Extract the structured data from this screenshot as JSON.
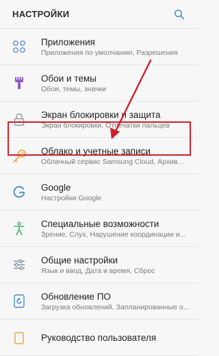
{
  "header": {
    "title": "НАСТРОЙКИ"
  },
  "items": [
    {
      "title": "Приложения",
      "subtitle": "Приложения по умолчанию, Разрешения",
      "icon": "apps-grid-icon",
      "color": "#5b8fd6"
    },
    {
      "title": "Обои и темы",
      "subtitle": "Обои, темы, значки",
      "icon": "paintbrush-icon",
      "color": "#8c5cc4"
    },
    {
      "title": "Экран блокировки и защита",
      "subtitle": "Экран блокировки, Отпечатки пальцев",
      "icon": "lock-icon",
      "color": "#9a9a9a"
    },
    {
      "title": "Облако и учетные записи",
      "subtitle": "Облачный сервис Samsung Cloud, Архив...",
      "icon": "key-icon",
      "color": "#f0a33c"
    },
    {
      "title": "Google",
      "subtitle": "Настройки Google",
      "icon": "google-g-icon",
      "color": "#3d86c6"
    },
    {
      "title": "Специальные возможности",
      "subtitle": "Зрение, Слух, Нарушение координации и...",
      "icon": "accessibility-icon",
      "color": "#44b06a"
    },
    {
      "title": "Общие настройки",
      "subtitle": "Язык и ввод, Дата и время, Сброс",
      "icon": "sliders-icon",
      "color": "#7e8ea6"
    },
    {
      "title": "Обновление ПО",
      "subtitle": "Загрузка обновлений, Запланированные о...",
      "icon": "software-update-icon",
      "color": "#3f8fd4"
    },
    {
      "title": "Руководство пользователя",
      "subtitle": "",
      "icon": "manual-icon",
      "color": "#f0a33c"
    }
  ],
  "annotation": {
    "highlight_color": "#d0202a"
  }
}
